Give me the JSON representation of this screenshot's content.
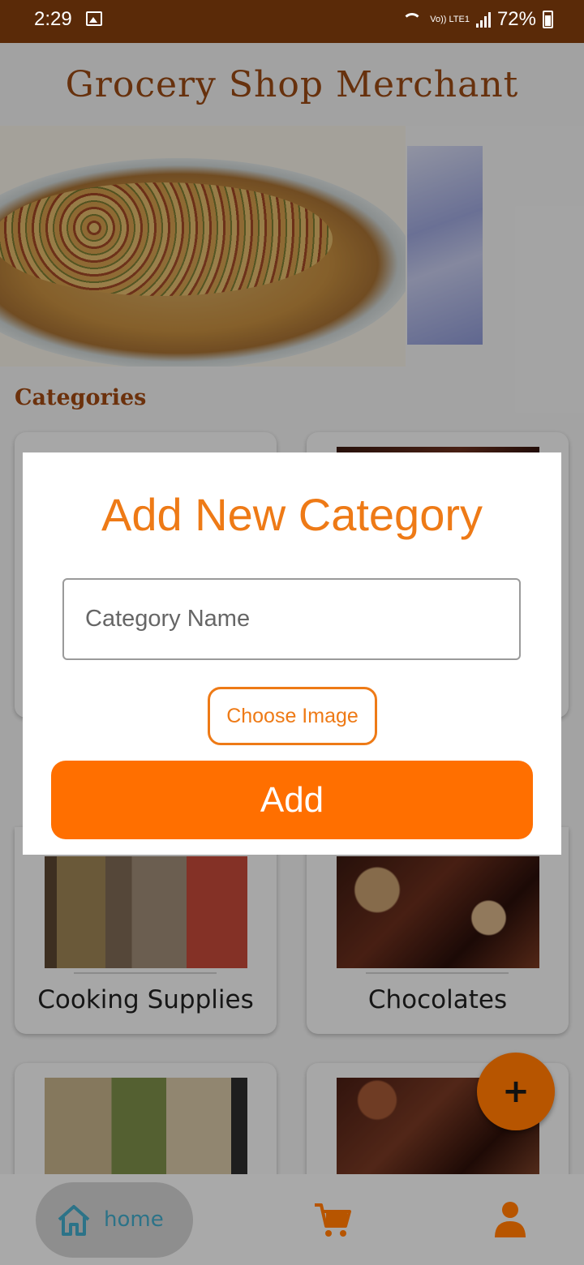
{
  "status_bar": {
    "time": "2:29",
    "network": "Vo)) LTE1",
    "battery": "72%"
  },
  "header": {
    "title": "Grocery Shop Merchant"
  },
  "categories_section": {
    "title": "Categories"
  },
  "categories": [
    {
      "label": "Cooking Supplies"
    },
    {
      "label": "Chocolates"
    }
  ],
  "dialog": {
    "title": "Add New Category",
    "name_placeholder": "Category Name",
    "choose_image_label": "Choose Image",
    "add_label": "Add"
  },
  "fab": {
    "icon": "plus-icon",
    "label": "+"
  },
  "bottom_nav": {
    "home_label": "home",
    "items": [
      "home-icon",
      "cart-icon",
      "profile-icon"
    ]
  },
  "colors": {
    "accent": "#ee7a16",
    "primary_button": "#ff6f00",
    "status_bar": "#5a2a08",
    "brand_text": "#9a4a14"
  }
}
